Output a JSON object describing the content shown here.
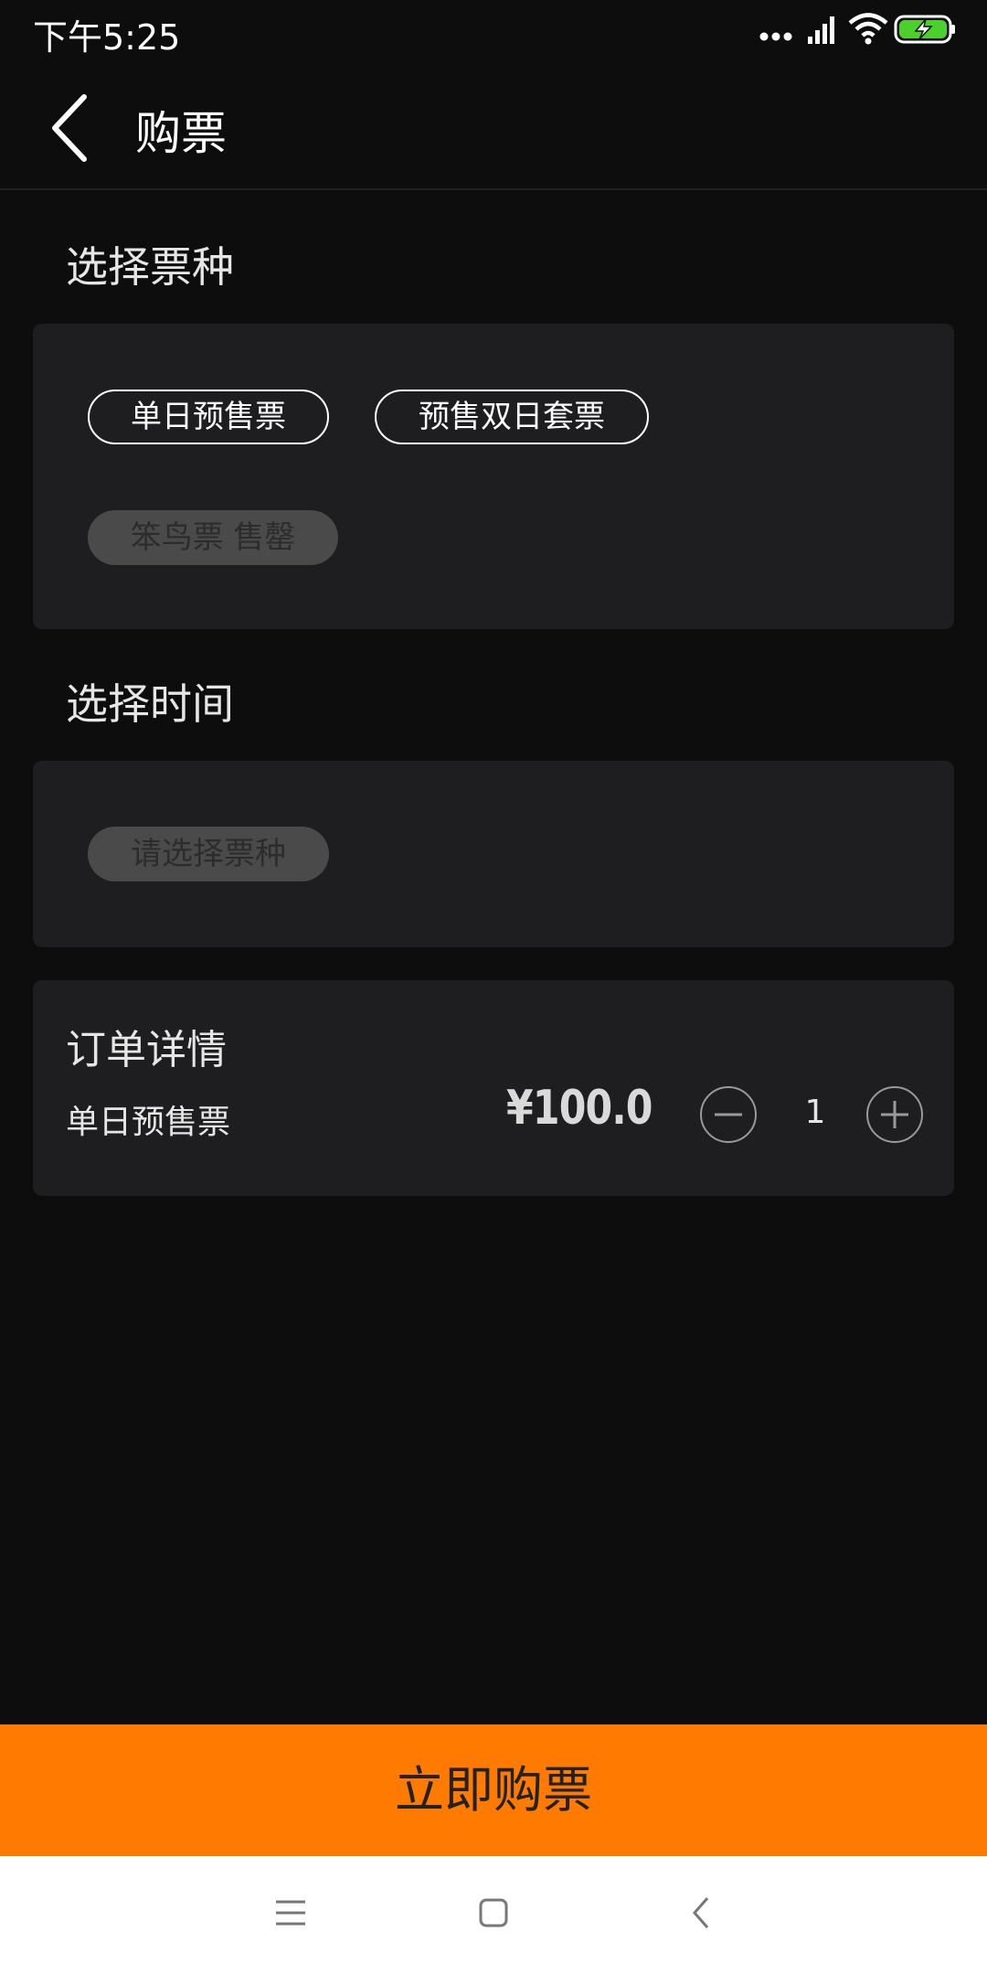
{
  "status_bar": {
    "time": "下午5:25",
    "icons": [
      "more-dots-icon",
      "signal-icon",
      "wifi-icon",
      "battery-charging-icon"
    ]
  },
  "header": {
    "title": "购票",
    "back_icon": "back-arrow-icon"
  },
  "ticket_type": {
    "label": "选择票种",
    "options": [
      {
        "label": "单日预售票",
        "state": "available"
      },
      {
        "label": "预售双日套票",
        "state": "available"
      },
      {
        "label": "笨鸟票 售罄",
        "state": "sold-out"
      }
    ]
  },
  "time_select": {
    "label": "选择时间",
    "placeholder": "请选择票种"
  },
  "order": {
    "title": "订单详情",
    "item_name": "单日预售票",
    "price": "¥100.0",
    "quantity": "1"
  },
  "buy_button": {
    "label": "立即购票"
  },
  "colors": {
    "accent": "#ff7a00",
    "background": "#0d0d0d",
    "card": "#1e1d1f",
    "battery": "#4cd02a"
  },
  "nav_bar": {
    "icons": [
      "menu-icon",
      "home-icon",
      "back-icon"
    ]
  }
}
